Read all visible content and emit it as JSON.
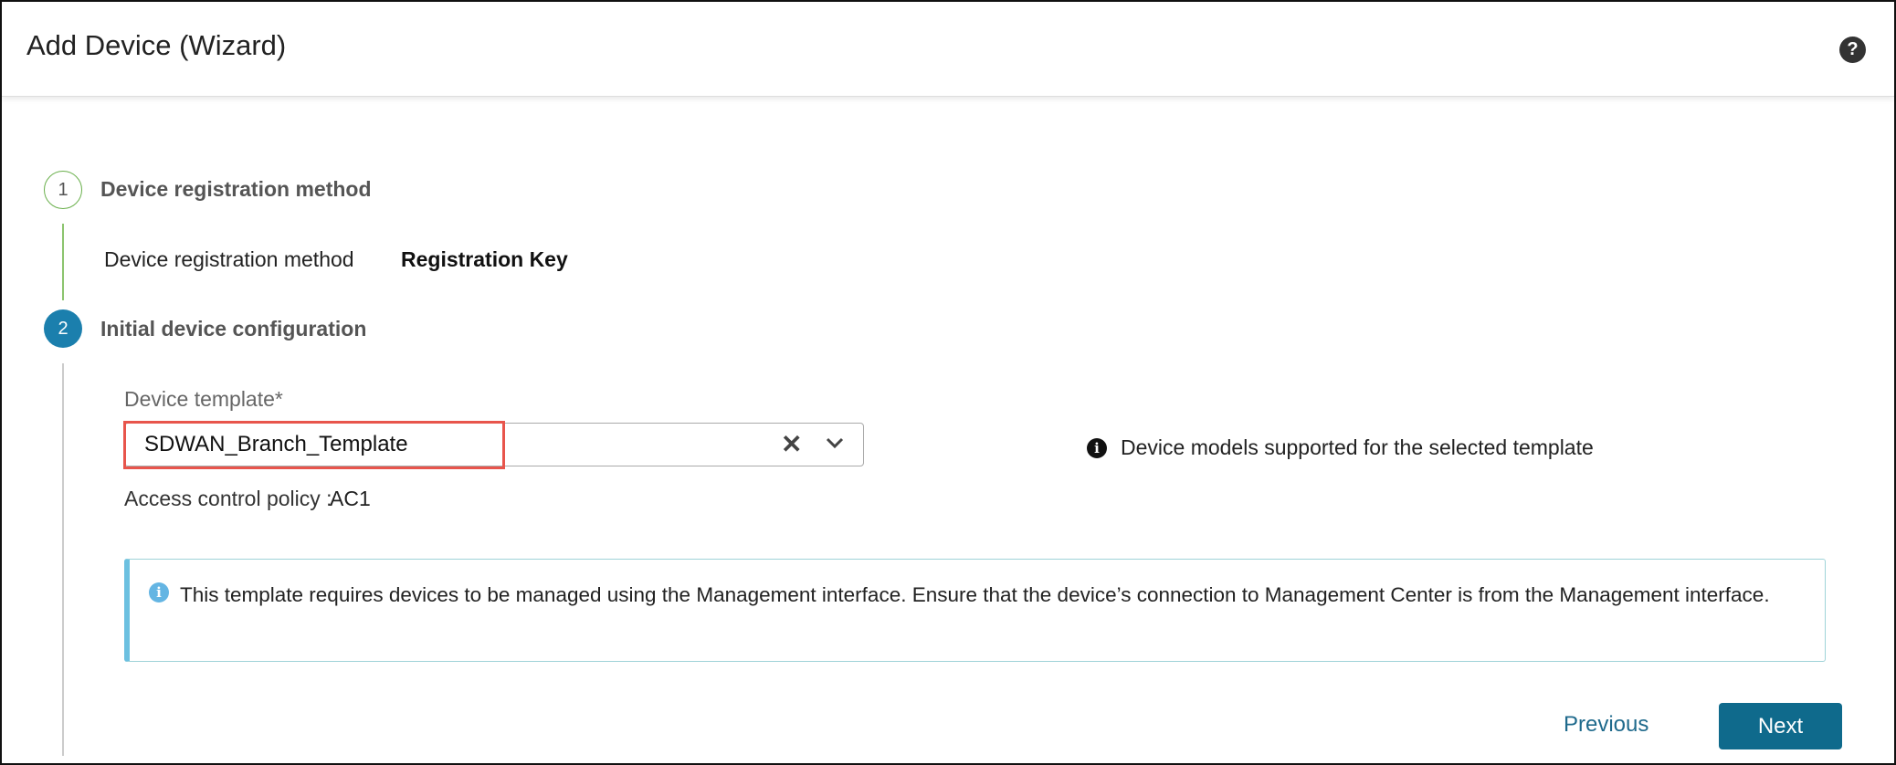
{
  "header": {
    "title": "Add Device (Wizard)",
    "help_icon": "?"
  },
  "steps": [
    {
      "number": "1",
      "title": "Device registration method",
      "field_label": "Device registration method",
      "field_value": "Registration Key"
    },
    {
      "number": "2",
      "title": "Initial device configuration"
    }
  ],
  "form": {
    "template_label": "Device template",
    "required_mark": "*",
    "template_value": "SDWAN_Branch_Template",
    "clear_icon": "✕",
    "supported_models_link": "Device models supported for the selected template",
    "acp_label": "Access control policy :",
    "acp_value": "AC1"
  },
  "alert": {
    "text": "This template requires devices to be managed using the Management interface. Ensure that the device’s connection to Management Center is from the Management interface."
  },
  "footer": {
    "previous_label": "Previous",
    "next_label": "Next"
  },
  "colors": {
    "accent": "#0f6a8c",
    "step_active": "#1b7fad",
    "step_done": "#6ab04c",
    "highlight": "#e8554c",
    "alert_border": "#6cc0e0"
  }
}
